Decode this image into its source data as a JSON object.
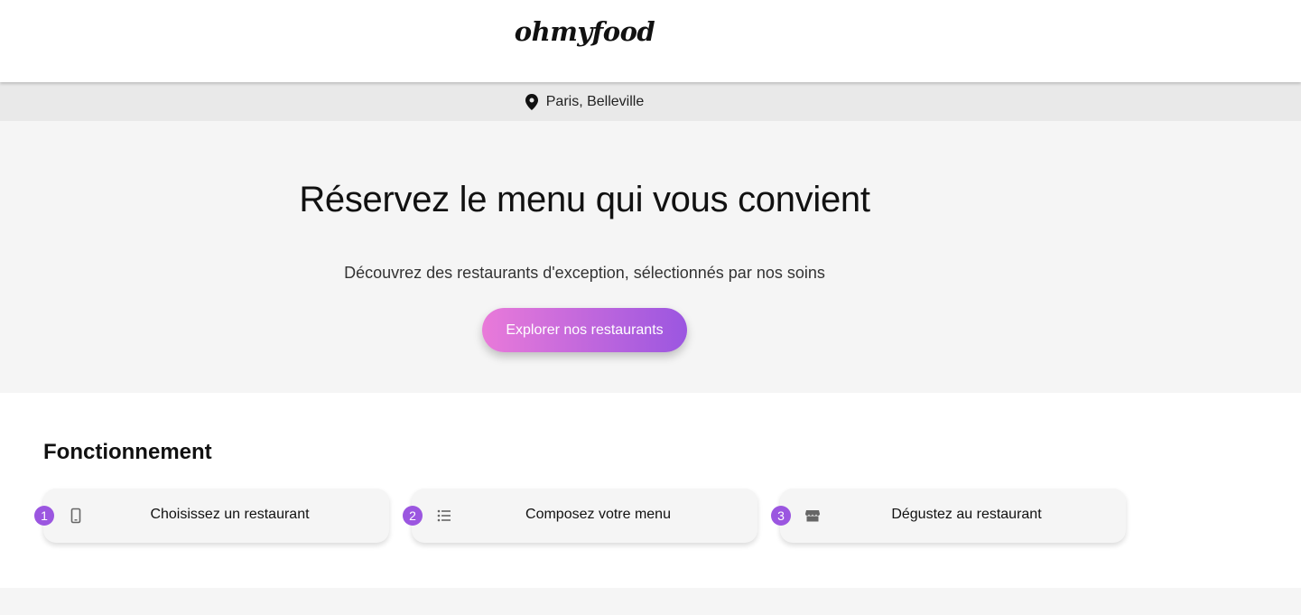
{
  "header": {
    "logo": "ohmyfood"
  },
  "location": {
    "icon": "map-pin-icon",
    "label": "Paris, Belleville"
  },
  "hero": {
    "title": "Réservez le menu qui vous convient",
    "subtitle": "Découvrez des restaurants d'exception, sélectionnés par nos soins",
    "cta_label": "Explorer nos restaurants"
  },
  "how": {
    "title": "Fonctionnement",
    "steps": [
      {
        "number": "1",
        "icon": "smartphone-icon",
        "label": "Choisissez un restaurant"
      },
      {
        "number": "2",
        "icon": "list-icon",
        "label": "Composez votre menu"
      },
      {
        "number": "3",
        "icon": "store-icon",
        "label": "Dégustez au restaurant"
      }
    ]
  },
  "colors": {
    "accent_start": "#e97ad9",
    "accent_end": "#9b56e0",
    "hero_bg": "#f5f5f5",
    "location_bg": "#e9e9e9"
  }
}
